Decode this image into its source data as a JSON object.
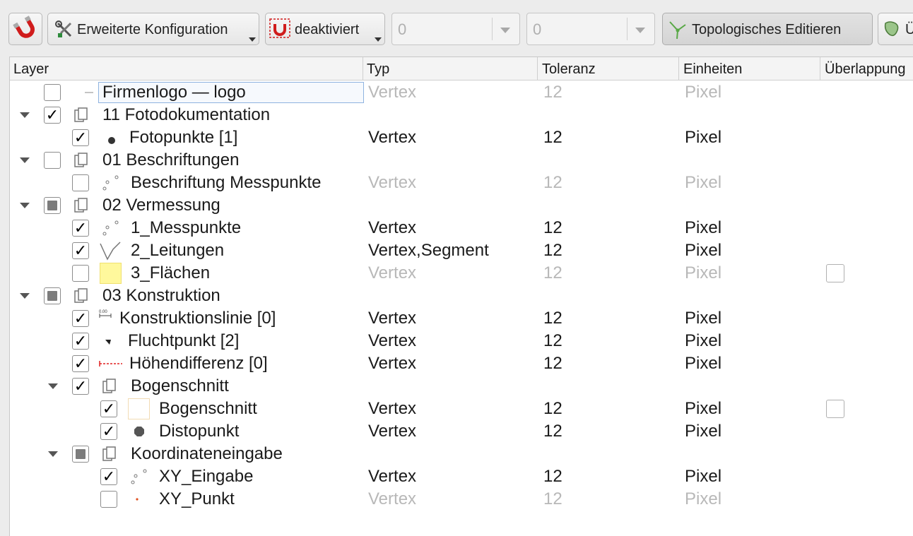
{
  "toolbar": {
    "snapping_icon": "magnet-icon",
    "advanced_config_label": "Erweiterte Konfiguration",
    "snapping_mode_label": "deaktiviert",
    "tolerance_value": "0",
    "units_value": "0",
    "topological_label": "Topologisches Editieren",
    "overlap_icon": "overlap-icon",
    "overlap_label_partial": "Ü"
  },
  "columns": [
    "Layer",
    "Typ",
    "Toleranz",
    "Einheiten",
    "Überlappung"
  ],
  "rows": [
    {
      "name": "Firmenlogo — logo",
      "typ": "Vertex",
      "tol": "12",
      "unit": "Pixel"
    },
    {
      "name": "11 Fotodokumentation"
    },
    {
      "name": "Fotopunkte [1]",
      "typ": "Vertex",
      "tol": "12",
      "unit": "Pixel"
    },
    {
      "name": "01 Beschriftungen"
    },
    {
      "name": "Beschriftung Messpunkte",
      "typ": "Vertex",
      "tol": "12",
      "unit": "Pixel"
    },
    {
      "name": "02 Vermessung"
    },
    {
      "name": "1_Messpunkte",
      "typ": "Vertex",
      "tol": "12",
      "unit": "Pixel"
    },
    {
      "name": "2_Leitungen",
      "typ": "Vertex,Segment",
      "tol": "12",
      "unit": "Pixel"
    },
    {
      "name": "3_Flächen",
      "typ": "Vertex",
      "tol": "12",
      "unit": "Pixel"
    },
    {
      "name": "03 Konstruktion"
    },
    {
      "name": "Konstruktionslinie [0]",
      "typ": "Vertex",
      "tol": "12",
      "unit": "Pixel"
    },
    {
      "name": "Fluchtpunkt [2]",
      "typ": "Vertex",
      "tol": "12",
      "unit": "Pixel"
    },
    {
      "name": "Höhendifferenz [0]",
      "typ": "Vertex",
      "tol": "12",
      "unit": "Pixel"
    },
    {
      "name": "Bogenschnitt"
    },
    {
      "name": "Bogenschnitt",
      "typ": "Vertex",
      "tol": "12",
      "unit": "Pixel"
    },
    {
      "name": "Distopunkt",
      "typ": "Vertex",
      "tol": "12",
      "unit": "Pixel"
    },
    {
      "name": "Koordinateneingabe"
    },
    {
      "name": "XY_Eingabe",
      "typ": "Vertex",
      "tol": "12",
      "unit": "Pixel"
    },
    {
      "name": "XY_Punkt",
      "typ": "Vertex",
      "tol": "12",
      "unit": "Pixel"
    }
  ]
}
